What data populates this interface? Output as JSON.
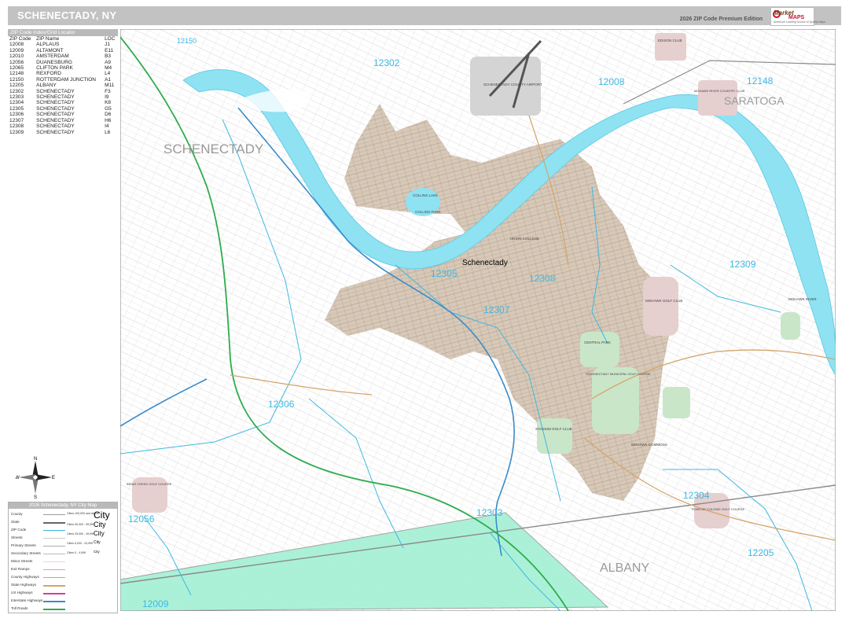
{
  "header": {
    "title": "SCHENECTADY, NY",
    "edition": "2026 ZIP Code Premium Edition",
    "logo_word1": "Market",
    "logo_word2": "MAPS",
    "logo_tagline": "America's Leading Source of Quality Maps"
  },
  "zip_index": {
    "heading": "ZIP Code Index/Grid Locator",
    "columns": [
      "ZIP Code",
      "ZIP Name",
      "LOC"
    ],
    "rows": [
      [
        "12008",
        "ALPLAUS",
        "J1"
      ],
      [
        "12009",
        "ALTAMONT",
        "E11"
      ],
      [
        "12010",
        "AMSTERDAM",
        "B3"
      ],
      [
        "12056",
        "DUANESBURG",
        "A9"
      ],
      [
        "12065",
        "CLIFTON PARK",
        "M4"
      ],
      [
        "12148",
        "REXFORD",
        "L4"
      ],
      [
        "12150",
        "ROTTERDAM JUNCTION",
        "A1"
      ],
      [
        "12205",
        "ALBANY",
        "M11"
      ],
      [
        "12302",
        "SCHENECTADY",
        "F3"
      ],
      [
        "12303",
        "SCHENECTADY",
        "I9"
      ],
      [
        "12304",
        "SCHENECTADY",
        "K8"
      ],
      [
        "12305",
        "SCHENECTADY",
        "G5"
      ],
      [
        "12306",
        "SCHENECTADY",
        "D6"
      ],
      [
        "12307",
        "SCHENECTADY",
        "H6"
      ],
      [
        "12308",
        "SCHENECTADY",
        "I4"
      ],
      [
        "12309",
        "SCHENECTADY",
        "L6"
      ]
    ]
  },
  "map": {
    "colors": {
      "city": "#d7c7b6",
      "water": "#8ee2f2",
      "park": "#c9e6c9",
      "albany_county": "#9ff0d0",
      "zip_label": "#3fb8e0",
      "county_label": "#9a9a9a"
    },
    "county_labels": [
      "SCHENECTADY",
      "SARATOGA",
      "ALBANY"
    ],
    "city_label": "Schenectady",
    "zip_labels": [
      "12150",
      "12302",
      "12008",
      "12148",
      "12305",
      "12308",
      "12307",
      "12309",
      "12306",
      "12304",
      "12056",
      "12303",
      "12205",
      "12009"
    ],
    "feature_labels": [
      "SCHENECTADY COUNTY AIRPORT",
      "EDISON CLUB",
      "MOHAWK RIVER COUNTRY CLUB",
      "COLLINS LAKE",
      "COLLINS PARK",
      "UNION COLLEGE",
      "CENTRAL PARK",
      "SCHENECTADY MUNICIPAL GOLF COURSE",
      "STADIUM GOLF CLUB",
      "MOHAWK GOLF CLUB",
      "BRIAR CREEK GOLF COURSE",
      "TOWN OF COLONIE GOLF COURSE",
      "MOHAWK COMMONS",
      "MOHAWK RIVER"
    ]
  },
  "legend": {
    "title": "2026 Schenectady, NY City Map",
    "items": [
      "County",
      "State",
      "ZIP Code",
      "Streets",
      "Primary Streets",
      "Secondary Streets",
      "Minor Streets",
      "Exit Ramps",
      "County Highways",
      "State Highways",
      "US Highways",
      "Interstate Highways",
      "Toll Roads"
    ],
    "city_samples": [
      "City",
      "City",
      "City",
      "City",
      "City"
    ],
    "population_notes": [
      "Cities 100,000 and above",
      "Cities 50,000 - 99,999",
      "Cities 25,000 - 49,999",
      "Cities 5,000 - 24,999",
      "Cities 0 - 4,999"
    ]
  },
  "compass": {
    "n": "N",
    "s": "S",
    "e": "E",
    "w": "W"
  }
}
